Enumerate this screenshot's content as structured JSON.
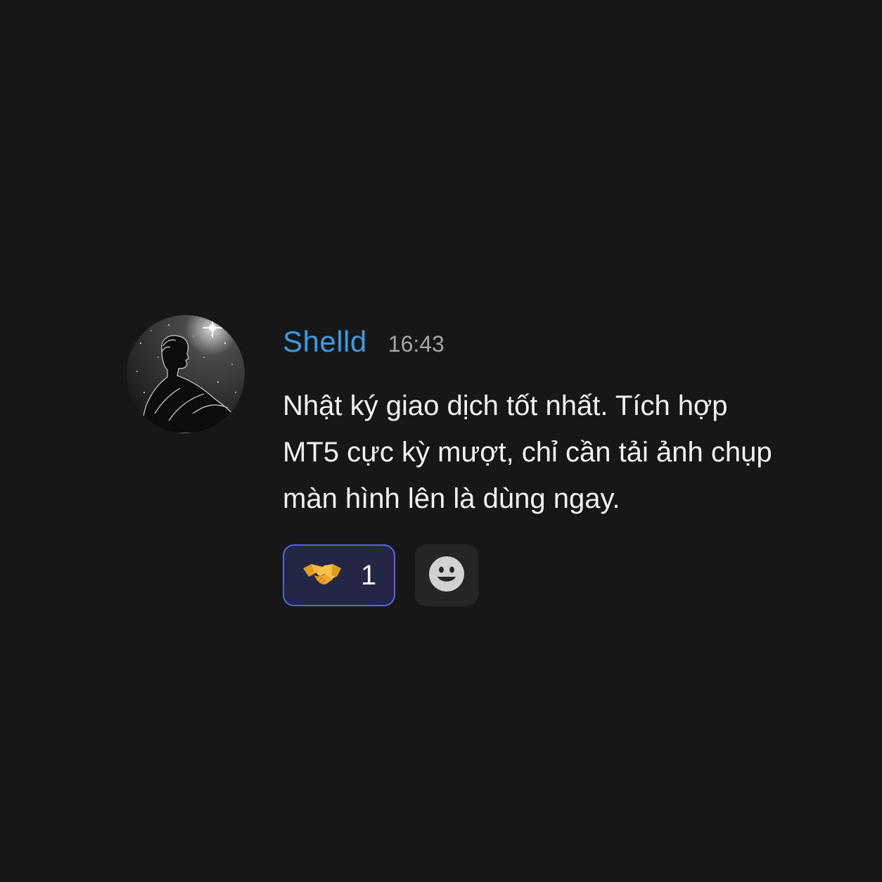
{
  "message": {
    "author": "Shelld",
    "timestamp": "16:43",
    "text": "Nhật ký giao dịch tốt nhất. Tích hợp MT5 cực kỳ mượt, chỉ cần tải ảnh chụp màn hình lên là dùng ngay.",
    "avatar_icon": "avatar-image"
  },
  "reactions": [
    {
      "emoji_icon": "handshake-icon",
      "count": "1",
      "reacted_by_me": true
    }
  ],
  "add_reaction": {
    "icon": "smiley-icon"
  },
  "colors": {
    "background": "#171718",
    "username": "#3a9be4",
    "timestamp": "#a4a5a9",
    "text": "#f2f2f3",
    "reaction_border": "#5962e6",
    "reaction_bg": "#232645"
  }
}
